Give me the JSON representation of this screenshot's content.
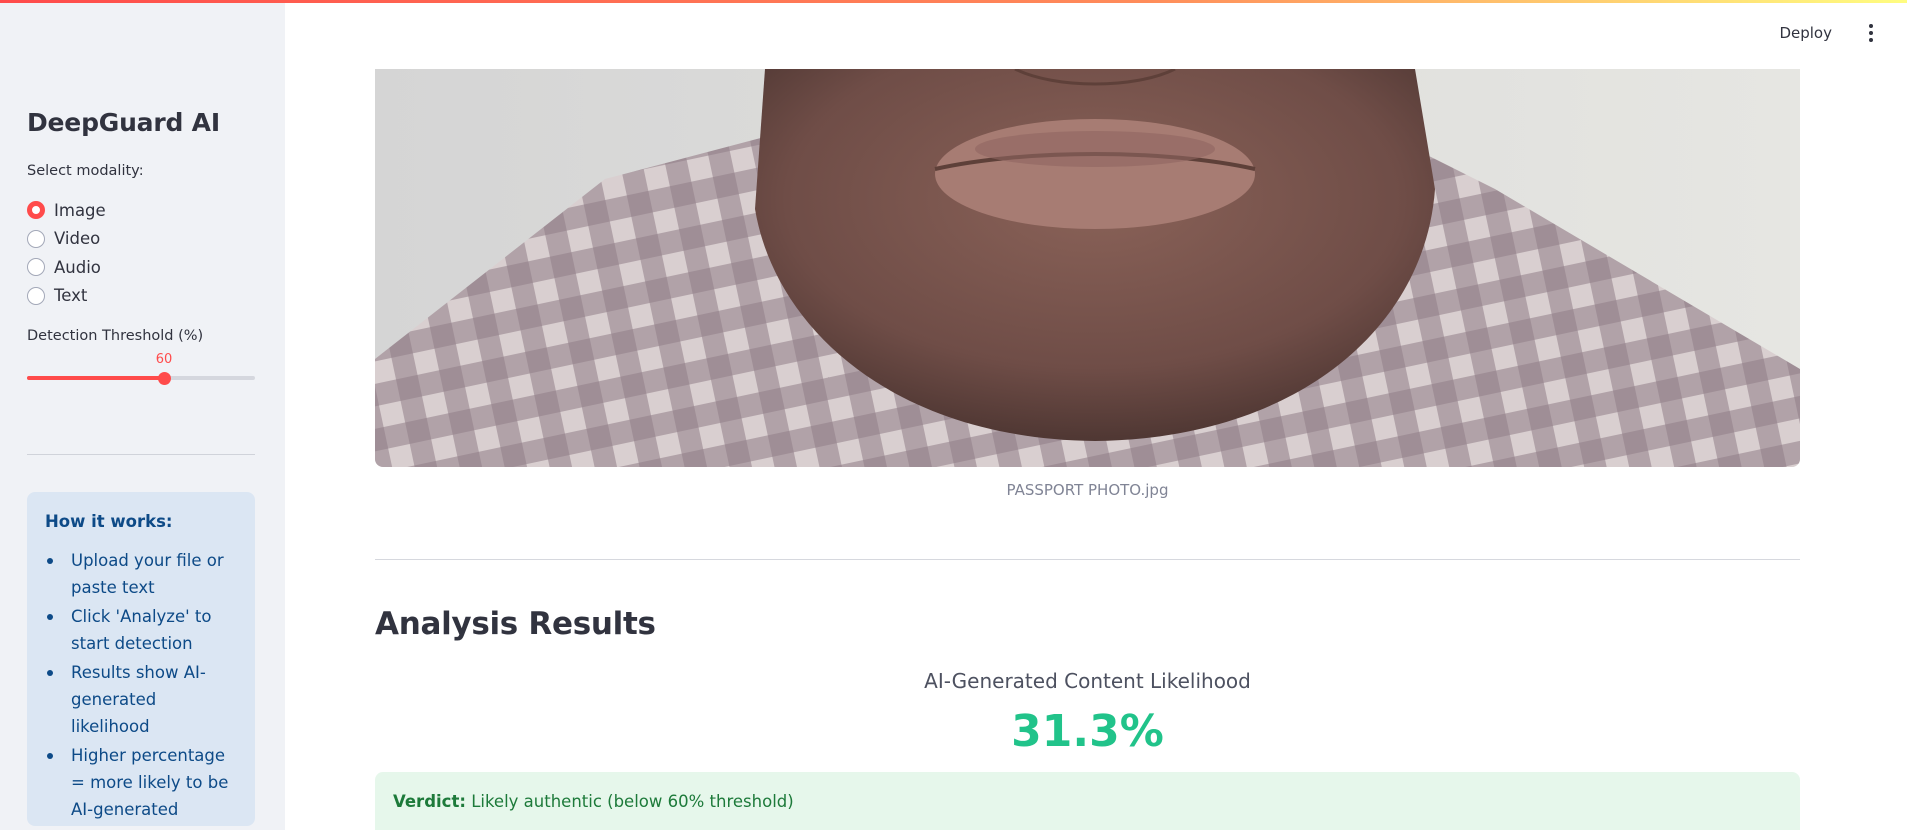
{
  "sidebar": {
    "app_title": "DeepGuard AI",
    "modality_label": "Select modality:",
    "modality_options": [
      "Image",
      "Video",
      "Audio",
      "Text"
    ],
    "modality_selected": "Image",
    "threshold_label": "Detection Threshold (%)",
    "threshold_value": "60",
    "threshold_min": 0,
    "threshold_max": 100,
    "info": {
      "title": "How it works:",
      "items": [
        "Upload your file or paste text",
        "Click 'Analyze' to start detection",
        "Results show AI-generated likelihood",
        "Higher percentage = more likely to be AI-generated"
      ]
    }
  },
  "header": {
    "deploy_label": "Deploy",
    "menu_icon": "kebab-menu-icon"
  },
  "main": {
    "image_caption": "PASSPORT PHOTO.jpg",
    "results_heading": "Analysis Results",
    "likelihood_label": "AI-Generated Content Likelihood",
    "likelihood_value": "31.3%",
    "verdict_label": "Verdict:",
    "verdict_text": "Likely authentic (below 60% threshold)"
  },
  "colors": {
    "accent": "#ff4b4b",
    "sidebar_bg": "#f0f2f6",
    "info_bg": "#dbe6f3",
    "info_text": "#0d4a87",
    "likelihood": "#21c38a",
    "verdict_bg": "#e6f7eb",
    "verdict_text": "#1d7a3a"
  }
}
